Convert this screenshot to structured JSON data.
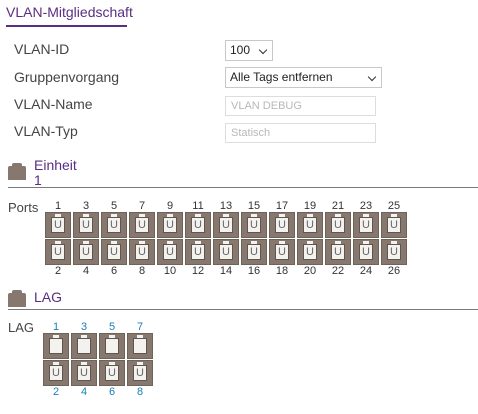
{
  "title": "VLAN-Mitgliedschaft",
  "form": {
    "vlan_id_label": "VLAN-ID",
    "vlan_id_value": "100",
    "group_op_label": "Gruppenvorgang",
    "group_op_value": "Alle Tags entfernen",
    "vlan_name_label": "VLAN-Name",
    "vlan_name_value": "VLAN DEBUG",
    "vlan_type_label": "VLAN-Typ",
    "vlan_type_value": "Statisch"
  },
  "unit_section": {
    "title": "Einheit",
    "number": "1"
  },
  "ports": {
    "label": "Ports",
    "top_numbers": [
      "1",
      "3",
      "5",
      "7",
      "9",
      "11",
      "13",
      "15",
      "17",
      "19",
      "21",
      "23",
      "25"
    ],
    "bottom_numbers": [
      "2",
      "4",
      "6",
      "8",
      "10",
      "12",
      "14",
      "16",
      "18",
      "20",
      "22",
      "24",
      "26"
    ],
    "top_states": [
      "U",
      "U",
      "U",
      "U",
      "U",
      "U",
      "U",
      "U",
      "U",
      "U",
      "U",
      "U",
      "U"
    ],
    "bottom_states": [
      "U",
      "U",
      "U",
      "U",
      "U",
      "U",
      "U",
      "U",
      "U",
      "U",
      "U",
      "U",
      "U"
    ]
  },
  "lag_section": {
    "title": "LAG"
  },
  "lags": {
    "label": "LAG",
    "top_numbers": [
      "1",
      "3",
      "5",
      "7"
    ],
    "bottom_numbers": [
      "2",
      "4",
      "6",
      "8"
    ],
    "top_states": [
      "",
      "",
      "",
      ""
    ],
    "bottom_states": [
      "U",
      "U",
      "U",
      "U"
    ]
  },
  "colors": {
    "accent": "#5a2d82",
    "port_frame": "#86786e",
    "lag_link": "#1a7fb5"
  }
}
